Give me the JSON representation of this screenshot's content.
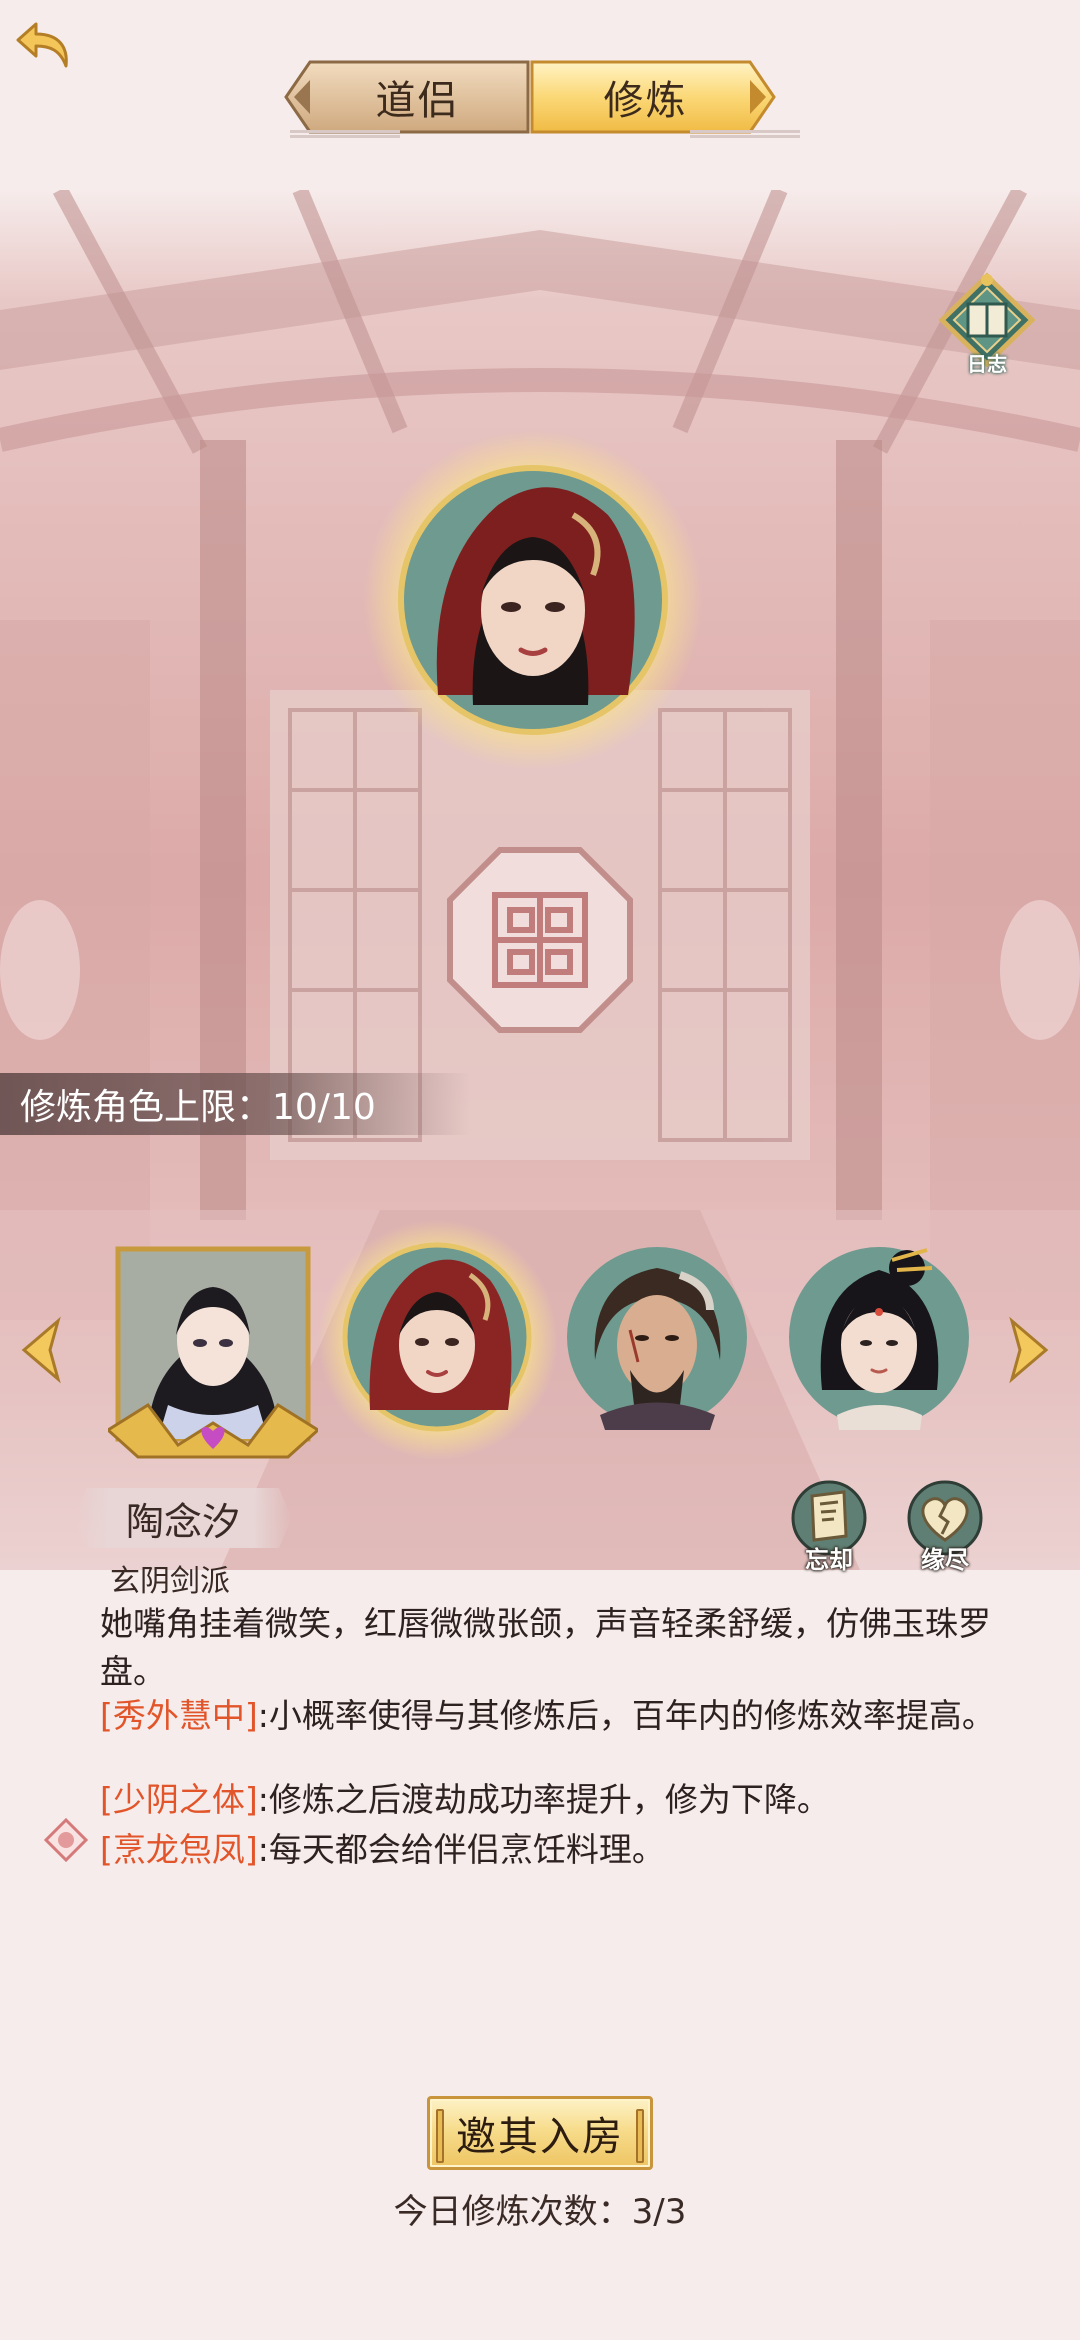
{
  "header": {
    "back_icon": "back-arrow-icon",
    "tabs": [
      {
        "label": "道侣",
        "selected": false
      },
      {
        "label": "修炼",
        "selected": true
      }
    ]
  },
  "scene": {
    "journal_label": "日志",
    "limit_text": "修炼角色上限：10/10"
  },
  "carousel": {
    "characters": [
      {
        "id": "char-1",
        "type": "female-npc-ornate-frame",
        "selected": false
      },
      {
        "id": "char-2",
        "type": "female-red-hood",
        "selected": true
      },
      {
        "id": "char-3",
        "type": "male-scarred-warrior",
        "selected": false
      },
      {
        "id": "char-4",
        "type": "female-gold-hairpin",
        "selected": false
      }
    ]
  },
  "character": {
    "name": "陶念汐",
    "sect": "玄阴剑派",
    "description": "她嘴角挂着微笑，红唇微微张颌，声音轻柔舒缓，仿佛玉珠罗盘。",
    "traits": [
      {
        "name": "[秀外慧中]",
        "text": ":小概率使得与其修炼后，百年内的修炼效率提高。"
      },
      {
        "name": "[少阴之体]",
        "text": ":修炼之后渡劫成功率提升，修为下降。"
      },
      {
        "name": "[烹龙炰凤]",
        "text": ":每天都会给伴侣烹饪料理。"
      }
    ]
  },
  "actions": {
    "forget_label": "忘却",
    "fate_label": "缘尽"
  },
  "footer": {
    "invite_label": "邀其入房",
    "count_text": "今日修炼次数：3/3"
  },
  "colors": {
    "background": "#f6eceb",
    "trait_name": "#e2552a",
    "gold": "#e9bb55",
    "teal": "#5c8a80"
  }
}
